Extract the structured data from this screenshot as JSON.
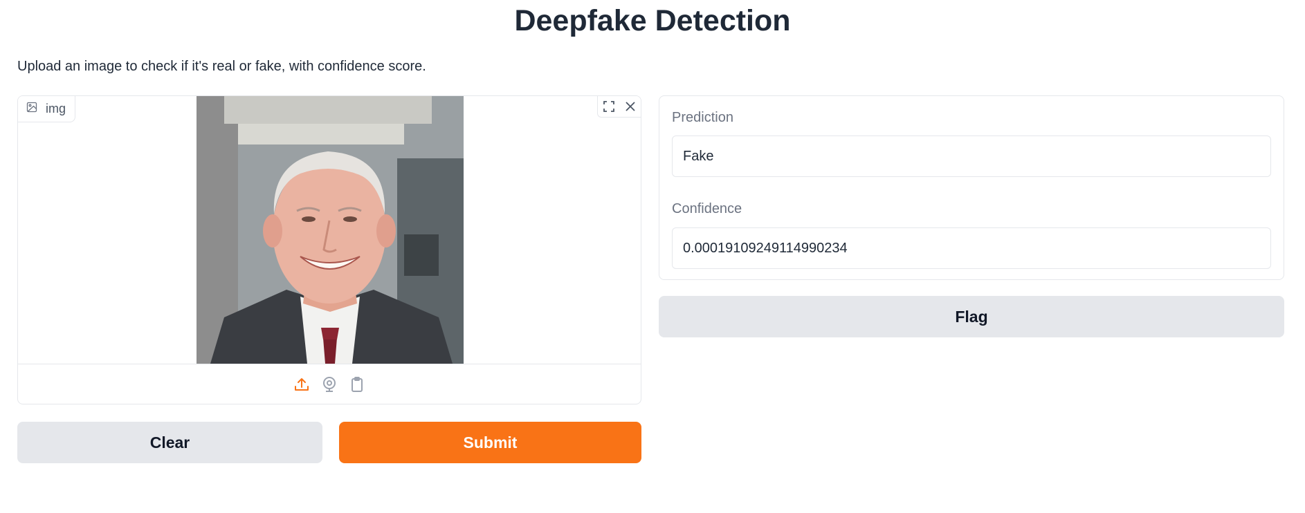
{
  "header": {
    "title": "Deepfake Detection",
    "description": "Upload an image to check if it's real or fake, with confidence score."
  },
  "image_input": {
    "label": "img",
    "icons": {
      "label_icon": "image-icon",
      "fullscreen": "fullscreen-icon",
      "clear": "close-icon",
      "upload": "upload-icon",
      "webcam": "webcam-icon",
      "clipboard": "clipboard-icon"
    }
  },
  "actions": {
    "clear_label": "Clear",
    "submit_label": "Submit",
    "flag_label": "Flag"
  },
  "outputs": {
    "prediction_label": "Prediction",
    "prediction_value": "Fake",
    "confidence_label": "Confidence",
    "confidence_value": "0.00019109249114990234"
  },
  "colors": {
    "primary": "#f97316",
    "secondary": "#e5e7eb",
    "text": "#1f2937",
    "muted": "#6b7280"
  }
}
